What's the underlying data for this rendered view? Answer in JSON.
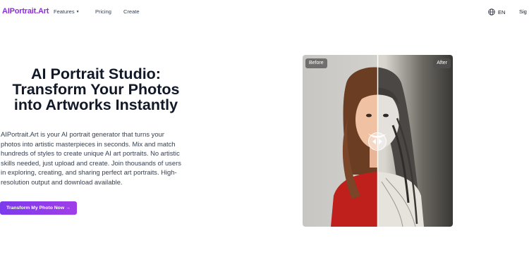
{
  "nav": {
    "logo": "AIPortrait.Art",
    "features": "Features",
    "pricing": "Pricing",
    "create": "Create",
    "language": "EN",
    "sign_in": "Sig"
  },
  "hero": {
    "title_lines": [
      "AI Portrait Studio:",
      "Transform Your Photos",
      "into Artworks Instantly"
    ],
    "description_lines": [
      "AIPortrait.Art is your AI portrait generator that turns your",
      "photos into artistic masterpieces in seconds. Mix and match",
      "hundreds of styles to create unique AI art portraits. No artistic",
      "skills needed, just upload and create. Join thousands of users",
      "in exploring, creating, and sharing perfect art portraits. High-",
      "resolution output and download available."
    ],
    "cta_label": "Transform My Photo Now →"
  },
  "compare": {
    "before_label": "Before",
    "after_label": "After"
  },
  "colors": {
    "brand": "#8b2fd6",
    "cta_start": "#7c3aed",
    "cta_end": "#a03ee8"
  }
}
